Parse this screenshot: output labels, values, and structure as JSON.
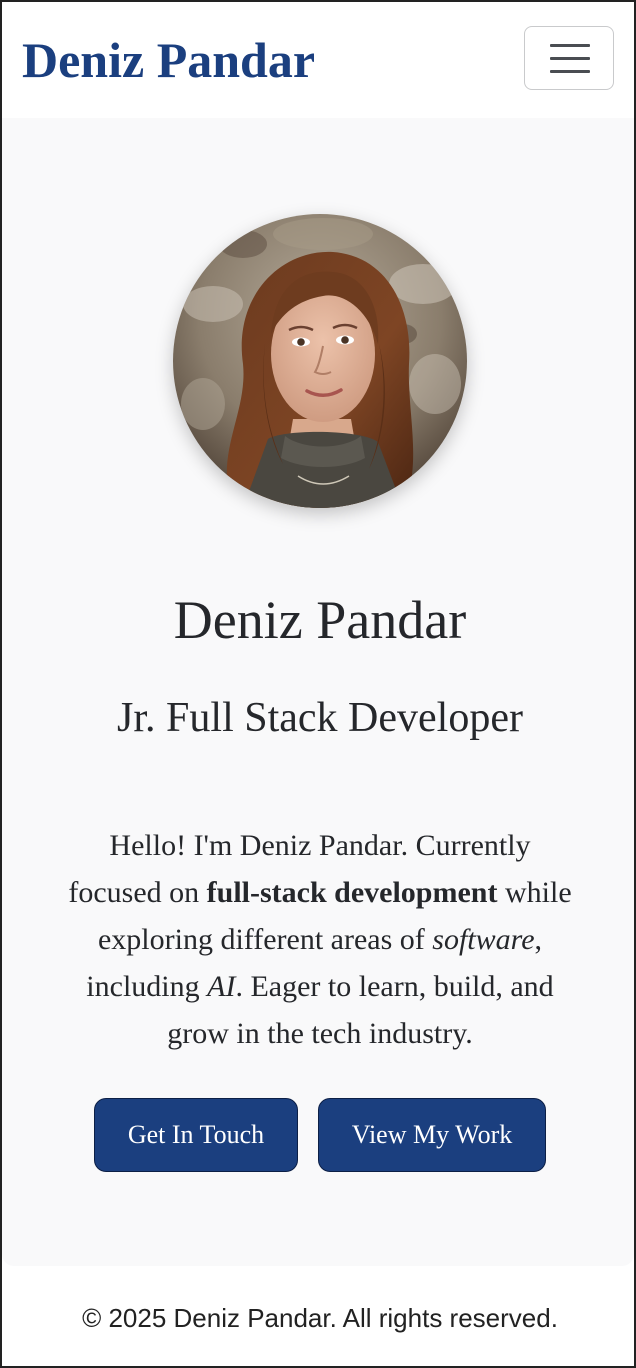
{
  "header": {
    "brand": "Deniz Pandar",
    "menu_icon": "hamburger-menu-icon"
  },
  "hero": {
    "photo_alt": "Portrait of Deniz Pandar",
    "name": "Deniz Pandar",
    "role": "Jr. Full Stack Developer",
    "bio": {
      "t1": "Hello! I'm Deniz Pandar. Currently focused on ",
      "bold": "full-stack development",
      "t2": " while exploring different areas of ",
      "italic1": "software",
      "t3": ", including ",
      "italic2": "AI",
      "t4": ". Eager to learn, build, and grow in the tech industry."
    },
    "buttons": {
      "contact": "Get In Touch",
      "work": "View My Work"
    }
  },
  "footer": {
    "copyright": "© 2025 Deniz Pandar. All rights reserved."
  },
  "colors": {
    "brand": "#1b3f7f",
    "hero_background": "#f9f9fa",
    "text": "#25272b"
  }
}
